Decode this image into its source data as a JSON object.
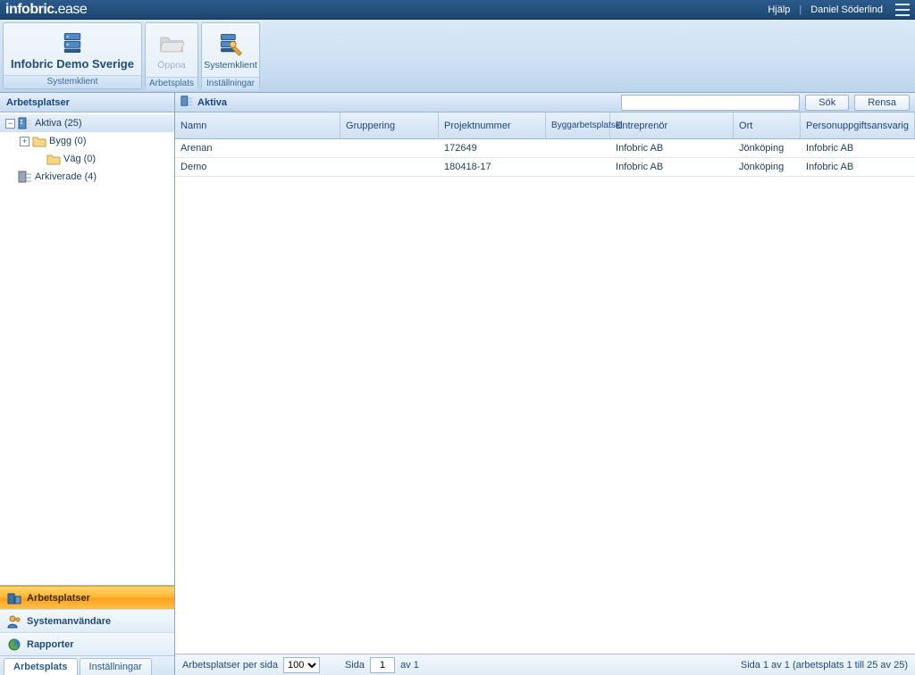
{
  "brand": {
    "left": "infobric",
    "right": "ease"
  },
  "topbar": {
    "help": "Hjälp",
    "user": "Daniel Söderlind"
  },
  "ribbon": {
    "group1_title": "Infobric Demo Sverige",
    "group1_label": "Systemklient",
    "group2_btn": "Öppna",
    "group2_label": "Arbetsplats",
    "group3_btn": "Systemklient",
    "group3_label": "Inställningar"
  },
  "sidebar": {
    "header": "Arbetsplatser",
    "tree": {
      "aktiva": "Aktiva (25)",
      "bygg": "Bygg (0)",
      "vag": "Väg (0)",
      "arkiverade": "Arkiverade (4)"
    },
    "nav": {
      "arbetsplatser": "Arbetsplatser",
      "systemanvandare": "Systemanvändare",
      "rapporter": "Rapporter"
    },
    "tabs": {
      "arbetsplats": "Arbetsplats",
      "installningar": "Inställningar"
    }
  },
  "content": {
    "title": "Aktiva",
    "search_btn": "Sök",
    "clear_btn": "Rensa",
    "columns": {
      "namn": "Namn",
      "gruppering": "Gruppering",
      "projektnummer": "Projektnummer",
      "byggarbetsplatsid": "Byggarbetsplatsid",
      "entreprenor": "Entreprenör",
      "ort": "Ort",
      "personuppgiftsansvarig": "Personuppgiftsansvarig"
    },
    "rows": [
      {
        "namn": "Arenan",
        "gruppering": "",
        "projektnummer": "172649",
        "byggid": "",
        "entreprenor": "Infobric AB",
        "ort": "Jönköping",
        "person": "Infobric AB"
      },
      {
        "namn": "Demo",
        "gruppering": "",
        "projektnummer": "180418-17",
        "byggid": "",
        "entreprenor": "Infobric AB",
        "ort": "Jönköping",
        "person": "Infobric AB"
      }
    ]
  },
  "footer": {
    "per_page_label": "Arbetsplatser per sida",
    "per_page_value": "100",
    "page_label": "Sida",
    "page_value": "1",
    "of_label": "av 1",
    "status": "Sida 1 av 1 (arbetsplats 1 till 25 av 25)"
  }
}
